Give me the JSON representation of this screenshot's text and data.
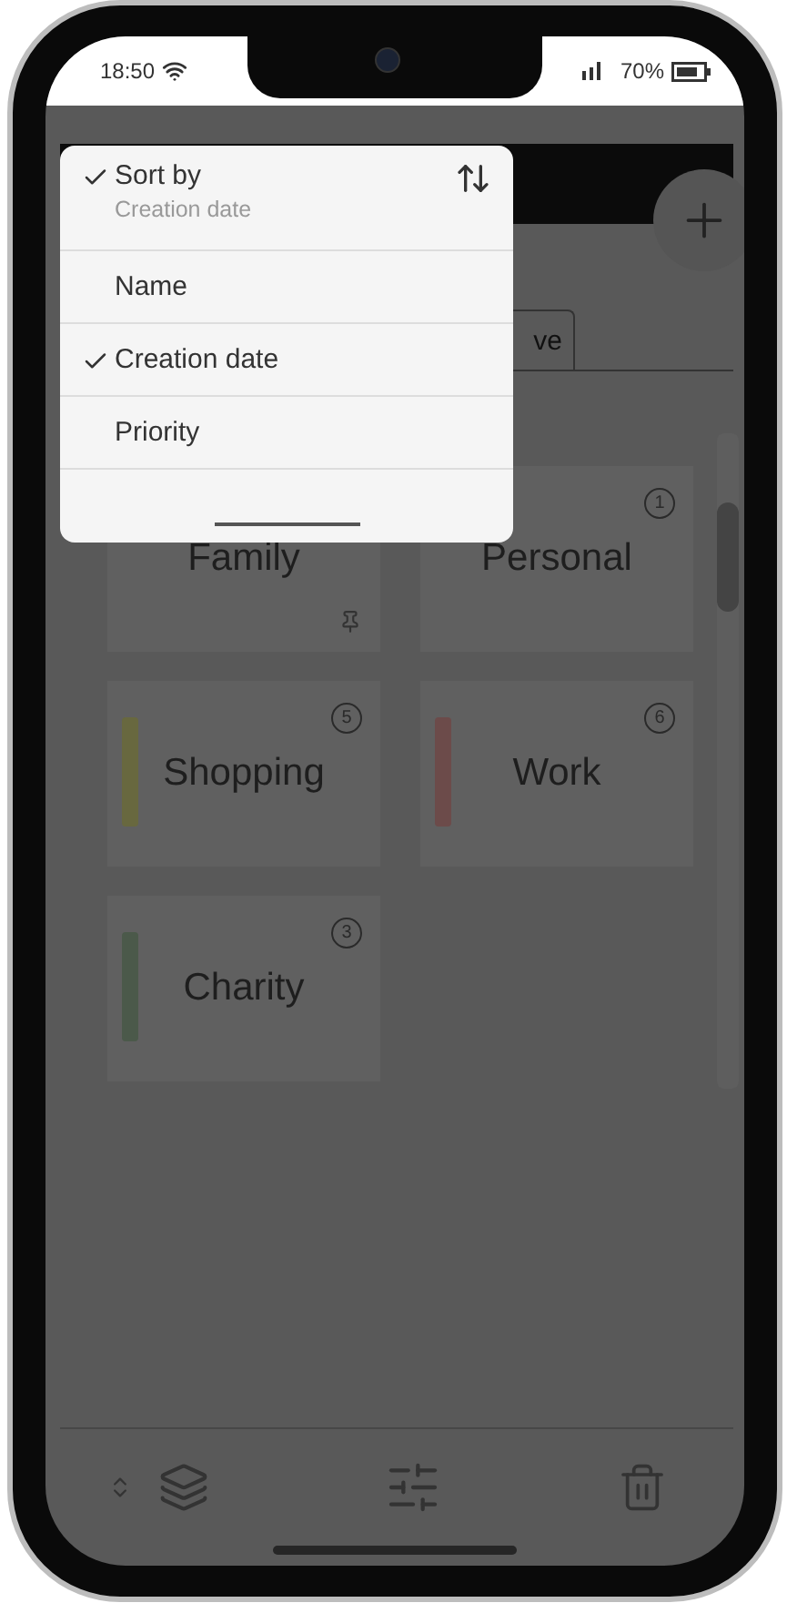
{
  "status_bar": {
    "time": "18:50",
    "battery": "70%"
  },
  "tabs": [
    {
      "label": "ve",
      "selected": false
    }
  ],
  "cards": [
    {
      "title": "Family",
      "pinned": true
    },
    {
      "title": "Personal",
      "count": "1",
      "pinned": false
    },
    {
      "title": "Shopping",
      "count": "5",
      "color": "#68683f",
      "pinned": false
    },
    {
      "title": "Work",
      "count": "6",
      "color": "#6c4b4a",
      "pinned": false
    },
    {
      "title": "Charity",
      "count": "3",
      "color": "#4b594a",
      "pinned": false
    }
  ],
  "sort_menu": {
    "title": "Sort by",
    "subtitle": "Creation date",
    "checked": true,
    "options": [
      {
        "label": "Name",
        "selected": false
      },
      {
        "label": "Creation date",
        "selected": true
      },
      {
        "label": "Priority",
        "selected": false
      }
    ]
  }
}
